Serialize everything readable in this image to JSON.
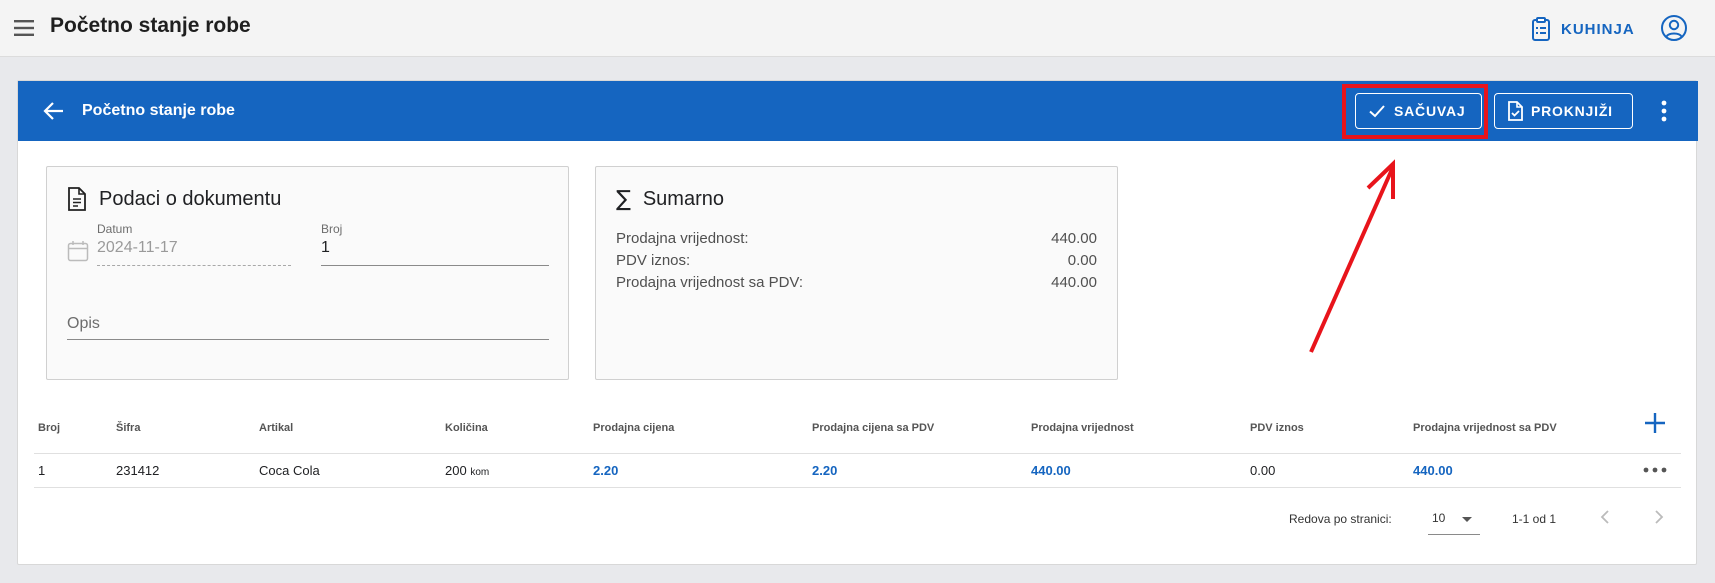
{
  "appbar": {
    "title": "Početno stanje robe",
    "kitchen_label": "KUHINJA"
  },
  "card": {
    "title": "Početno stanje robe",
    "save_label": "SAČUVAJ",
    "post_label": "PROKNJIŽI"
  },
  "document_panel": {
    "title": "Podaci o dokumentu",
    "date_label": "Datum",
    "date_value": "2024-11-17",
    "number_label": "Broj",
    "number_value": "1",
    "description_placeholder": "Opis"
  },
  "summary_panel": {
    "title": "Sumarno",
    "rows": [
      {
        "label": "Prodajna vrijednost:",
        "value": "440.00"
      },
      {
        "label": "PDV iznos:",
        "value": "0.00"
      },
      {
        "label": "Prodajna vrijednost sa PDV:",
        "value": "440.00"
      }
    ]
  },
  "table": {
    "columns": [
      "Broj",
      "Šifra",
      "Artikal",
      "Količina",
      "Prodajna cijena",
      "Prodajna cijena sa PDV",
      "Prodajna vrijednost",
      "PDV iznos",
      "Prodajna vrijednost sa PDV"
    ],
    "rows": [
      {
        "broj": "1",
        "sifra": "231412",
        "artikal": "Coca Cola",
        "kolicina": "200",
        "jedinica": "kom",
        "prodajna_cijena": "2.20",
        "prodajna_cijena_pdv": "2.20",
        "prodajna_vrijednost": "440.00",
        "pdv_iznos": "0.00",
        "prodajna_vrijednost_pdv": "440.00"
      }
    ]
  },
  "pagination": {
    "rows_per_page_label": "Redova po stranici:",
    "rows_per_page_value": "10",
    "range_text": "1-1 od 1"
  },
  "colors": {
    "primary": "#1565c0",
    "highlight": "#e8141b",
    "background": "#e8e9ec"
  },
  "icons": [
    "menu-icon",
    "clipboard-list-icon",
    "account-circle-icon",
    "arrow-left-icon",
    "check-icon",
    "file-check-icon",
    "more-vert-icon",
    "document-icon",
    "calendar-icon",
    "sigma-icon",
    "plus-icon",
    "more-horiz-icon",
    "chevron-left-icon",
    "chevron-right-icon"
  ]
}
